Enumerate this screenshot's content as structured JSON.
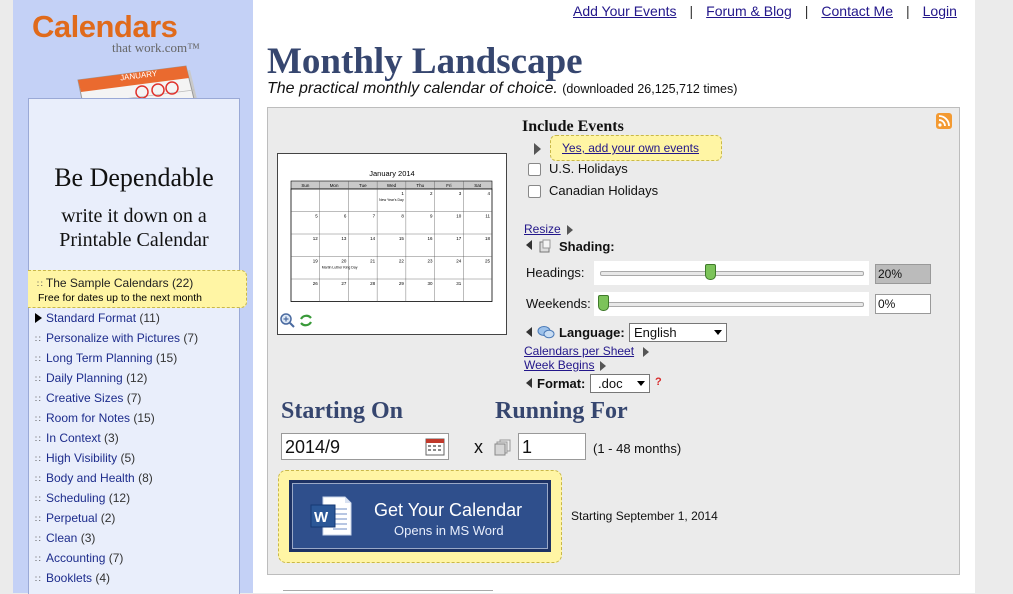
{
  "brand": {
    "name": "Calendars",
    "sub": "that work.com™",
    "art_month": "JANUARY"
  },
  "header_links": [
    "Add Your Events",
    "Forum & Blog",
    "Contact Me",
    "Login"
  ],
  "sidebar": {
    "tagline_1": "Be Dependable",
    "tagline_2": "write it down on a Printable Calendar",
    "highlight": {
      "label": "The Sample Calendars",
      "count": "(22)",
      "note": "Free for dates up to the next month"
    },
    "items": [
      {
        "label": "Standard Format",
        "count": "(11)",
        "current": true
      },
      {
        "label": "Personalize with Pictures",
        "count": "(7)"
      },
      {
        "label": "Long Term Planning",
        "count": "(15)"
      },
      {
        "label": "Daily Planning",
        "count": "(12)"
      },
      {
        "label": "Creative Sizes",
        "count": "(7)"
      },
      {
        "label": "Room for Notes",
        "count": "(15)"
      },
      {
        "label": "In Context",
        "count": "(3)"
      },
      {
        "label": "High Visibility",
        "count": "(5)"
      },
      {
        "label": "Body and Health",
        "count": "(8)"
      },
      {
        "label": "Scheduling",
        "count": "(12)"
      },
      {
        "label": "Perpetual",
        "count": "(2)"
      },
      {
        "label": "Clean",
        "count": "(3)"
      },
      {
        "label": "Accounting",
        "count": "(7)"
      },
      {
        "label": "Booklets",
        "count": "(4)"
      }
    ]
  },
  "page": {
    "title": "Monthly Landscape",
    "subtitle": "The practical monthly calendar of choice.",
    "downloads": "(downloaded 26,125,712 times)"
  },
  "preview": {
    "month_title": "January 2014",
    "weekdays": [
      "Sun",
      "Mon",
      "Tue",
      "Wed",
      "Thu",
      "Fri",
      "Sat"
    ],
    "weeks": [
      [
        "",
        "",
        "",
        "1",
        "2",
        "3",
        "4"
      ],
      [
        "5",
        "6",
        "7",
        "8",
        "9",
        "10",
        "11"
      ],
      [
        "12",
        "13",
        "14",
        "15",
        "16",
        "17",
        "18"
      ],
      [
        "19",
        "20",
        "21",
        "22",
        "23",
        "24",
        "25"
      ],
      [
        "26",
        "27",
        "28",
        "29",
        "30",
        "31",
        ""
      ]
    ],
    "events": {
      "0-3": "New Year's Day",
      "3-1": "Martin Luther King Day"
    }
  },
  "events": {
    "title": "Include Events",
    "yes_link": "Yes, add your own events",
    "options": [
      "U.S. Holidays",
      "Canadian Holidays"
    ]
  },
  "options": {
    "resize": "Resize",
    "shading": "Shading:",
    "headings_label": "Headings:",
    "headings_value": "20%",
    "headings_level": 0.4,
    "weekends_label": "Weekends:",
    "weekends_value": "0%",
    "weekends_level": 0,
    "language_label": "Language:",
    "language_value": "English",
    "per_sheet": "Calendars per Sheet",
    "week_begins": "Week Begins",
    "format_label": "Format:",
    "format_value": ".doc",
    "help": "?"
  },
  "starting": {
    "label": "Starting On",
    "value": "2014/9"
  },
  "running": {
    "label": "Running For",
    "times": "x",
    "value": "1",
    "range": "(1 - 48 months)"
  },
  "get_button": {
    "line1": "Get Your Calendar",
    "line2": "Opens in MS Word"
  },
  "start_note": "Starting September 1, 2014",
  "colors": {
    "sidebar": "#c4d1f6",
    "title": "#36466f",
    "highlight": "#fff5a4",
    "button": "#2f4f8c",
    "link": "#22168a",
    "brand": "#e06a1b"
  }
}
